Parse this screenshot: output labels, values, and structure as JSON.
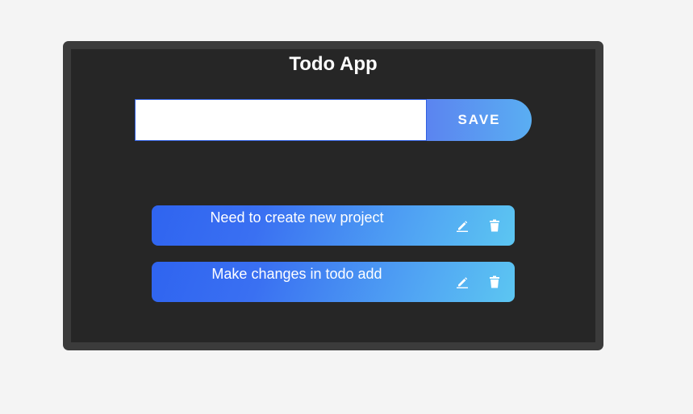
{
  "app": {
    "title": "Todo App"
  },
  "form": {
    "input_value": "",
    "input_placeholder": "",
    "save_label": "SAVE"
  },
  "todos": [
    {
      "text": "Need to create new project",
      "edit_icon": "pencil-icon",
      "delete_icon": "trash-icon"
    },
    {
      "text": "Make changes in todo add",
      "edit_icon": "pencil-icon",
      "delete_icon": "trash-icon"
    }
  ],
  "colors": {
    "page_background": "#f4f4f4",
    "frame_border": "#3b3b3b",
    "panel_background": "#262626",
    "accent_start": "#2f64f0",
    "accent_end": "#5cc6f2"
  }
}
